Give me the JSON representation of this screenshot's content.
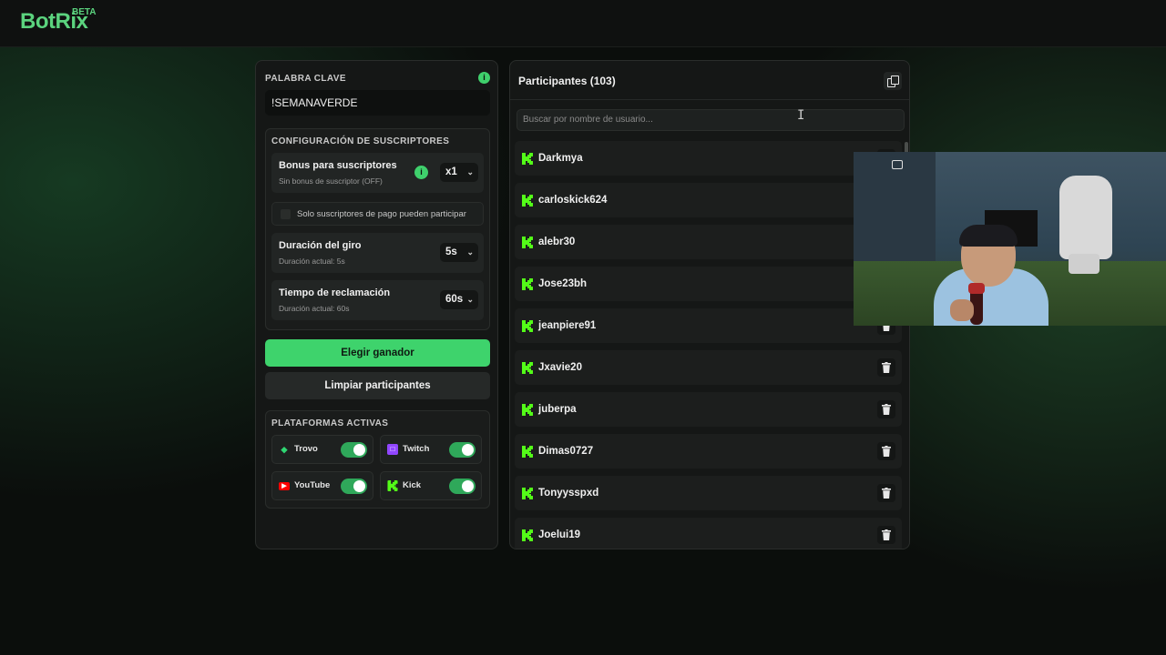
{
  "app": {
    "brand": "BotRix",
    "badge": "BETA"
  },
  "left": {
    "keyword_label": "PALABRA CLAVE",
    "keyword_value": "!SEMANAVERDE",
    "subs_section_title": "CONFIGURACIÓN DE SUSCRIPTORES",
    "bonus": {
      "title": "Bonus para suscriptores",
      "subtitle": "Sin bonus de suscriptor (OFF)",
      "value": "x1"
    },
    "only_paid_label": "Solo suscriptores de pago pueden participar",
    "spin": {
      "title": "Duración del giro",
      "subtitle": "Duración actual: 5s",
      "value": "5s"
    },
    "claim": {
      "title": "Tiempo de reclamación",
      "subtitle": "Duración actual: 60s",
      "value": "60s"
    },
    "pick_winner_label": "Elegir ganador",
    "clear_label": "Limpiar participantes",
    "platforms_title": "PLATAFORMAS ACTIVAS",
    "platforms": [
      {
        "name": "Trovo",
        "enabled": true,
        "color": "#2fd672"
      },
      {
        "name": "Twitch",
        "enabled": true,
        "color": "#9146ff"
      },
      {
        "name": "YouTube",
        "enabled": true,
        "color": "#ff0000"
      },
      {
        "name": "Kick",
        "enabled": true,
        "color": "#53fc18"
      }
    ]
  },
  "right": {
    "title": "Participantes (103)",
    "search_placeholder": "Buscar por nombre de usuario...",
    "participants": [
      "Darkmya",
      "carloskick624",
      "alebr30",
      "Jose23bh",
      "jeanpiere91",
      "Jxavie20",
      "juberpa",
      "Dimas0727",
      "Tonyysspxd",
      "Joelui19"
    ]
  },
  "colors": {
    "accent": "#3ed36c",
    "kick": "#53fc18"
  }
}
